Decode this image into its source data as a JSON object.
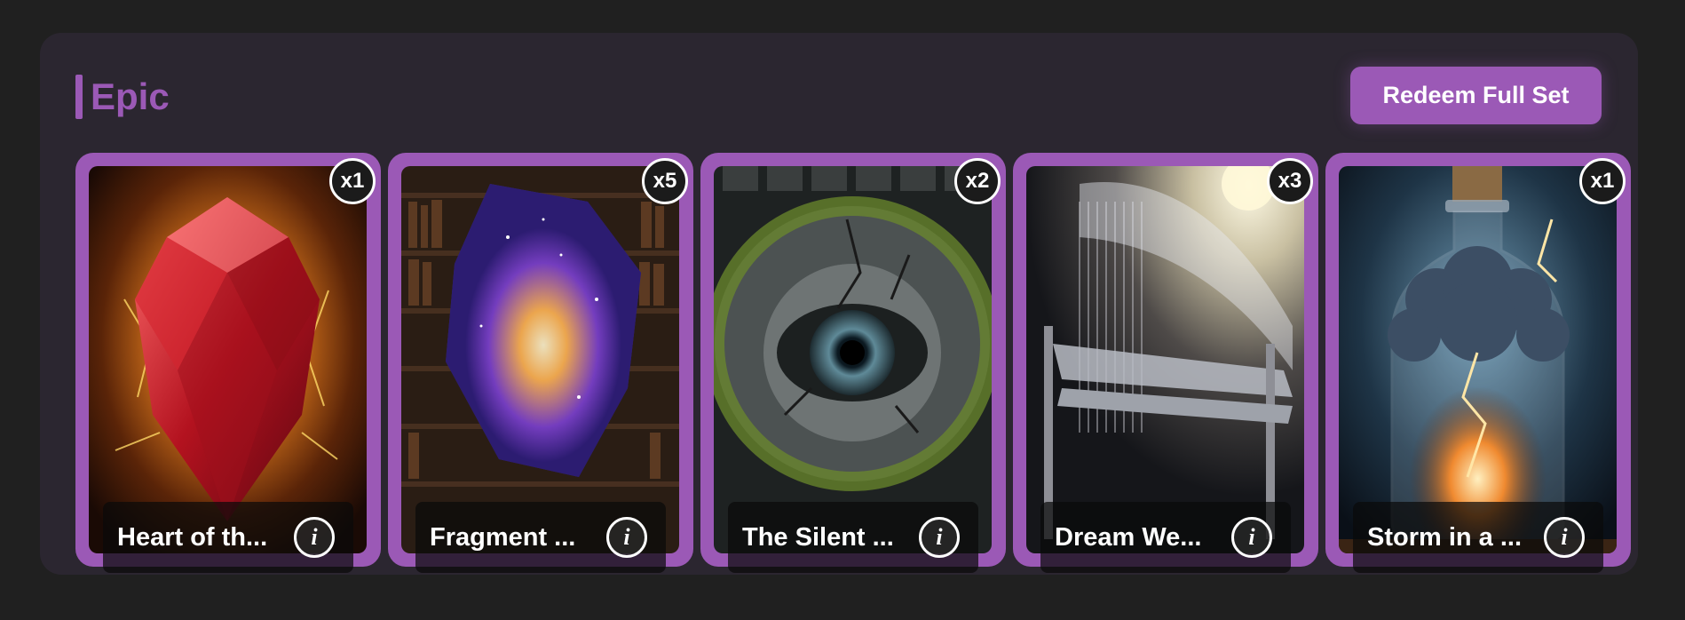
{
  "section": {
    "title": "Epic",
    "accent_color": "#9b59b6",
    "redeem_label": "Redeem Full Set"
  },
  "cards": [
    {
      "name": "Heart of th...",
      "quantity": "x1",
      "art_icon": "ruby-heart-crystal",
      "info_label": "i"
    },
    {
      "name": "Fragment ...",
      "quantity": "x5",
      "art_icon": "cosmic-crystal-fragment",
      "info_label": "i"
    },
    {
      "name": "The Silent ...",
      "quantity": "x2",
      "art_icon": "stone-eye",
      "info_label": "i"
    },
    {
      "name": "Dream We...",
      "quantity": "x3",
      "art_icon": "dream-loom",
      "info_label": "i"
    },
    {
      "name": "Storm in a ...",
      "quantity": "x1",
      "art_icon": "storm-bottle",
      "info_label": "i"
    }
  ]
}
